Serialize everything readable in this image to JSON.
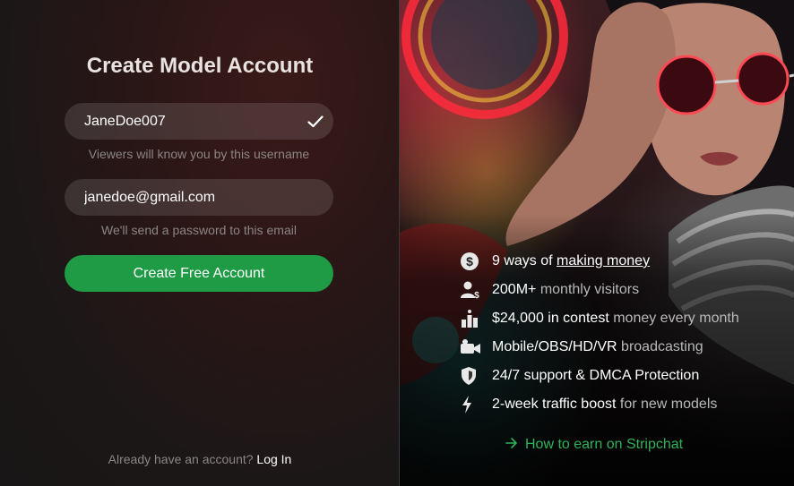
{
  "form": {
    "title": "Create Model Account",
    "username": {
      "value": "JaneDoe007",
      "valid": true,
      "hint": "Viewers will know you by this username"
    },
    "email": {
      "value": "janedoe@gmail.com",
      "hint": "We'll send a password to this email"
    },
    "submit_label": "Create Free Account",
    "login_prompt": "Already have an account?",
    "login_link": "Log In"
  },
  "features": [
    {
      "icon": "dollar-coin-icon",
      "pre": "9 ways of ",
      "link": "making money",
      "bold": "",
      "muted": ""
    },
    {
      "icon": "users-icon",
      "pre": "",
      "link": "",
      "bold": "200M+",
      "muted": " monthly visitors"
    },
    {
      "icon": "trophy-icon",
      "pre": "",
      "link": "",
      "bold": "$24,000 in contest",
      "muted": " money every month"
    },
    {
      "icon": "camera-icon",
      "pre": "",
      "link": "",
      "bold": "Mobile/OBS/HD/VR",
      "muted": " broadcasting"
    },
    {
      "icon": "shield-icon",
      "pre": "",
      "link": "",
      "bold": "24/7 support & DMCA Protection",
      "muted": ""
    },
    {
      "icon": "lightning-icon",
      "pre": "",
      "link": "",
      "bold": "2-week traffic boost",
      "muted": " for new models"
    }
  ],
  "earn_link": "How to earn on Stripchat",
  "colors": {
    "accent_green": "#1f9a45",
    "link_green": "#2fb35a"
  }
}
